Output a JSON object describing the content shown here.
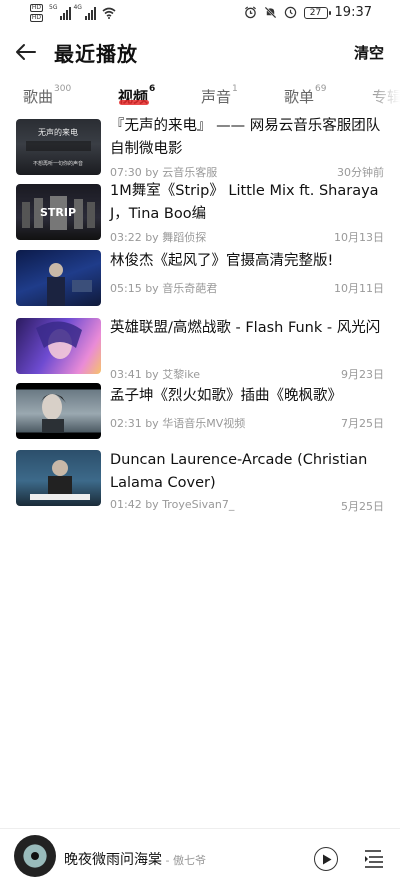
{
  "status_bar": {
    "sim1": "HD",
    "sim2": "HD",
    "net1": "5G",
    "net2": "4G",
    "battery": "27",
    "time": "19:37"
  },
  "header": {
    "title": "最近播放",
    "clear_label": "清空"
  },
  "tabs": [
    {
      "label": "歌曲",
      "count": "300"
    },
    {
      "label": "视频",
      "count": "6"
    },
    {
      "label": "声音",
      "count": "1"
    },
    {
      "label": "歌单",
      "count": "69"
    },
    {
      "label": "专辑",
      "count": ""
    }
  ],
  "videos": [
    {
      "title": "『无声的来电』 —— 网易云音乐客服团队自制微电影",
      "duration": "07:30",
      "by": "by",
      "author": "云音乐客服",
      "time": "30分钟前"
    },
    {
      "title": "1M舞室《Strip》 Little Mix ft. Sharaya J，Tina Boo编",
      "duration": "03:22",
      "by": "by",
      "author": "舞蹈侦探",
      "time": "10月13日"
    },
    {
      "title": "林俊杰《起风了》官摄高清完整版!",
      "duration": "05:15",
      "by": "by",
      "author": "音乐奇葩君",
      "time": "10月11日"
    },
    {
      "title": "英雄联盟/高燃战歌 - Flash Funk - 风光闪",
      "duration": "03:41",
      "by": "by",
      "author": "艾黎ike",
      "time": "9月23日"
    },
    {
      "title": "孟子坤《烈火如歌》插曲《晚枫歌》",
      "duration": "02:31",
      "by": "by",
      "author": "华语音乐MV视频",
      "time": "7月25日"
    },
    {
      "title": "Duncan Laurence-Arcade (Christian Lalama Cover)",
      "duration": "01:42",
      "by": "by",
      "author": "TroyeSivan7_",
      "time": "5月25日"
    }
  ],
  "thumb_text": {
    "t1_top": "无声的来电",
    "t1_bottom": "不想再听一句你的声音",
    "t2_word": "STRIP"
  },
  "player": {
    "song": "晚夜微雨问海棠",
    "separator": " - ",
    "singer": "傲七爷"
  },
  "icons": {
    "back": "arrow-left-icon",
    "play": "play-icon",
    "queue": "playlist-icon"
  }
}
